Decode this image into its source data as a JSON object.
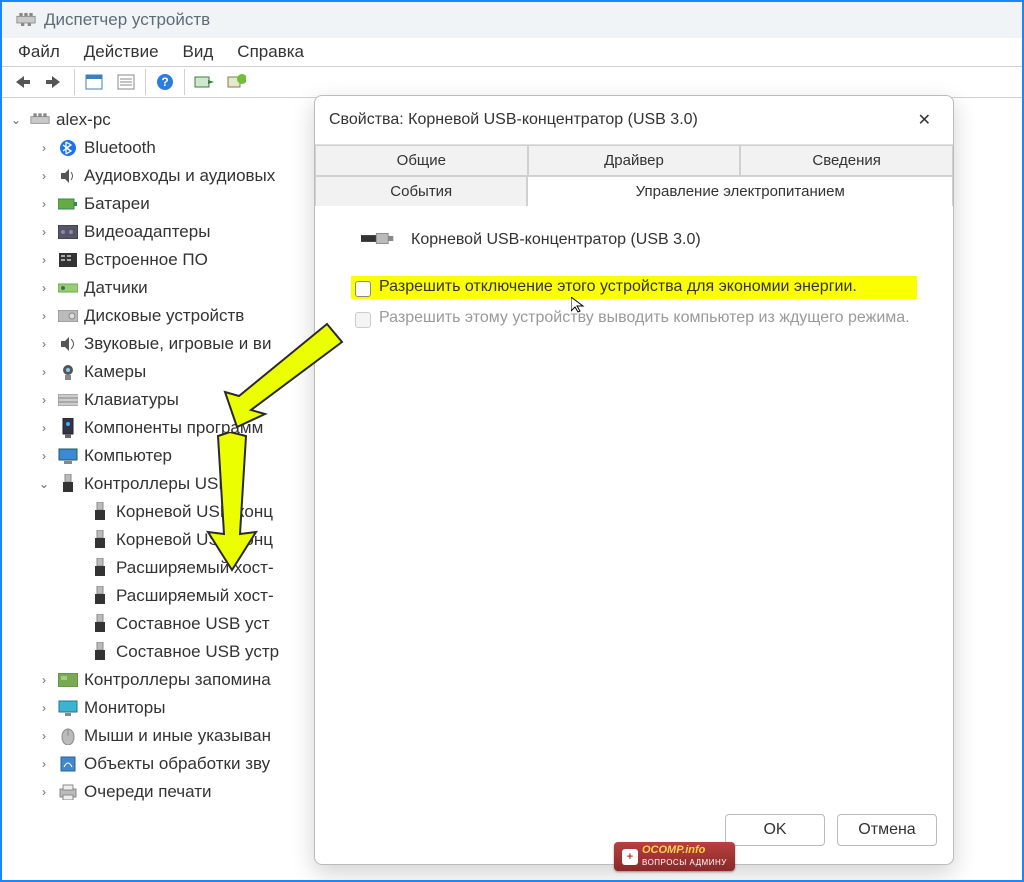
{
  "window": {
    "title": "Диспетчер устройств"
  },
  "menu": {
    "file": "Файл",
    "action": "Действие",
    "view": "Вид",
    "help": "Справка"
  },
  "tree": {
    "root": "alex-pc",
    "items": [
      {
        "icon": "bluetooth",
        "label": "Bluetooth",
        "exp": "closed"
      },
      {
        "icon": "audio",
        "label": "Аудиовходы и аудиовых",
        "exp": "closed"
      },
      {
        "icon": "battery",
        "label": "Батареи",
        "exp": "closed"
      },
      {
        "icon": "video",
        "label": "Видеоадаптеры",
        "exp": "closed"
      },
      {
        "icon": "firmware",
        "label": "Встроенное ПО",
        "exp": "closed"
      },
      {
        "icon": "sensor",
        "label": "Датчики",
        "exp": "closed"
      },
      {
        "icon": "disk",
        "label": "Дисковые устройств",
        "exp": "closed"
      },
      {
        "icon": "sound",
        "label": "Звуковые, игровые и ви",
        "exp": "closed"
      },
      {
        "icon": "camera",
        "label": "Камеры",
        "exp": "closed"
      },
      {
        "icon": "keyboard",
        "label": "Клавиатуры",
        "exp": "closed"
      },
      {
        "icon": "component",
        "label": "Компоненты программ",
        "exp": "closed"
      },
      {
        "icon": "computer",
        "label": "Компьютер",
        "exp": "closed"
      },
      {
        "icon": "usb",
        "label": "Контроллеры USB",
        "exp": "open",
        "children": [
          {
            "icon": "usb-port",
            "label": "Корневой USB-конц"
          },
          {
            "icon": "usb-port",
            "label": "Корневой USB-конц"
          },
          {
            "icon": "usb-port",
            "label": "Расширяемый хост-"
          },
          {
            "icon": "usb-port",
            "label": "Расширяемый хост-"
          },
          {
            "icon": "usb-port",
            "label": "Составное USB уст"
          },
          {
            "icon": "usb-port",
            "label": "Составное USB устр"
          }
        ]
      },
      {
        "icon": "storage",
        "label": "Контроллеры запомина",
        "exp": "closed"
      },
      {
        "icon": "monitor",
        "label": "Мониторы",
        "exp": "closed"
      },
      {
        "icon": "mouse",
        "label": "Мыши и иные указыван",
        "exp": "closed"
      },
      {
        "icon": "object",
        "label": "Объекты обработки зву",
        "exp": "closed"
      },
      {
        "icon": "printer",
        "label": "Очереди печати",
        "exp": "closed"
      }
    ]
  },
  "dialog": {
    "title": "Свойства: Корневой USB-концентратор (USB 3.0)",
    "tabs": {
      "general": "Общие",
      "driver": "Драйвер",
      "details": "Сведения",
      "events": "События",
      "power": "Управление электропитанием"
    },
    "device": "Корневой USB-концентратор (USB 3.0)",
    "opt1": "Разрешить отключение этого устройства для экономии энергии.",
    "opt2": "Разрешить этому устройству выводить компьютер из ждущего режима.",
    "ok": "OK",
    "cancel": "Отмена"
  },
  "badge": {
    "main": "OCOMP.info",
    "sub": "ВОПРОСЫ АДМИНУ"
  }
}
